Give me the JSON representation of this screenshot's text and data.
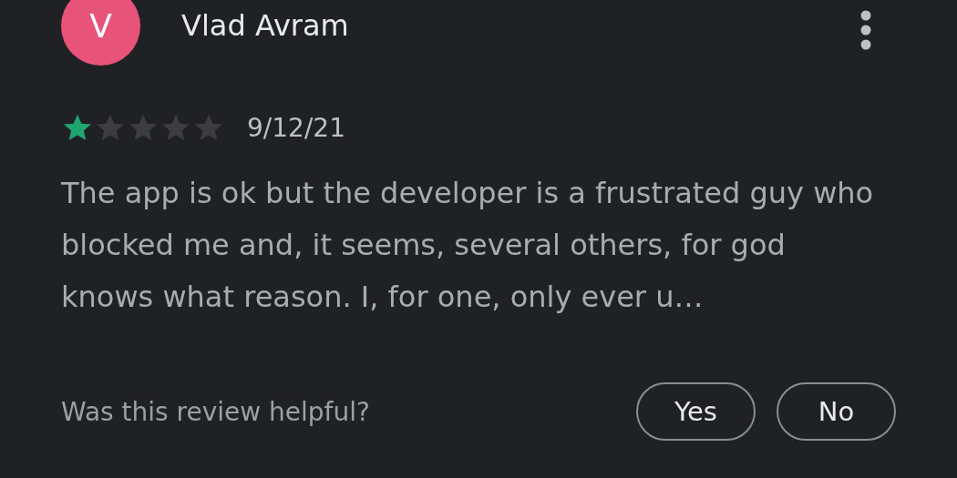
{
  "review": {
    "avatar_letter": "V",
    "author": "Vlad Avram",
    "stars": 1,
    "date": "9/12/21",
    "text": "The app is ok but the developer is a frustrated guy who blocked me and, it seems, several others, for god knows what reason. I, for one, only ever u…"
  },
  "helpful": {
    "question": "Was this review helpful?",
    "buttons": [
      "Yes",
      "No"
    ]
  }
}
